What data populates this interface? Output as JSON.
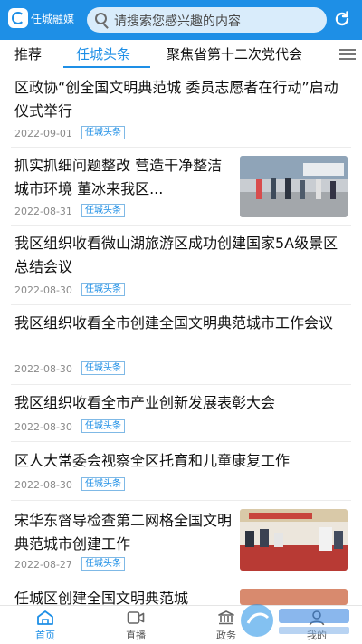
{
  "header": {
    "app_name": "任城融媒",
    "search_placeholder": "请搜索您感兴趣的内容"
  },
  "tabs": [
    {
      "label": "推荐"
    },
    {
      "label": "任城头条"
    },
    {
      "label": "聚焦省第十二次党代会"
    }
  ],
  "articles": [
    {
      "title": "区政协“创全国文明典范城 委员志愿者在行动”启动仪式举行",
      "date": "2022-09-01",
      "tag": "任城头条"
    },
    {
      "title": "抓实抓细问题整改 营造干净整洁城市环境 董冰来我区...",
      "date": "2022-08-31",
      "tag": "任城头条"
    },
    {
      "title": "我区组织收看微山湖旅游区成功创建国家5A级景区总结会议",
      "date": "2022-08-30",
      "tag": "任城头条"
    },
    {
      "title": "我区组织收看全市创建全国文明典范城市工作会议",
      "date": "2022-08-30",
      "tag": "任城头条"
    },
    {
      "title": "我区组织收看全市产业创新发展表彰大会",
      "date": "2022-08-30",
      "tag": "任城头条"
    },
    {
      "title": "区人大常委会视察全区托育和儿童康复工作",
      "date": "2022-08-30",
      "tag": "任城头条"
    },
    {
      "title": "宋华东督导检查第二网格全国文明典范城市创建工作",
      "date": "2022-08-27",
      "tag": "任城头条"
    },
    {
      "title": "任城区创建全国文明典范城",
      "date": "",
      "tag": ""
    }
  ],
  "bottom_nav": [
    {
      "label": "首页",
      "icon": "home-icon"
    },
    {
      "label": "直播",
      "icon": "video-icon"
    },
    {
      "label": "政务",
      "icon": "government-icon"
    },
    {
      "label": "我的",
      "icon": "user-icon"
    }
  ],
  "colors": {
    "accent": "#1e8fe6",
    "date_gray": "#8a8a8a",
    "tag_border": "#7fb9e6"
  }
}
